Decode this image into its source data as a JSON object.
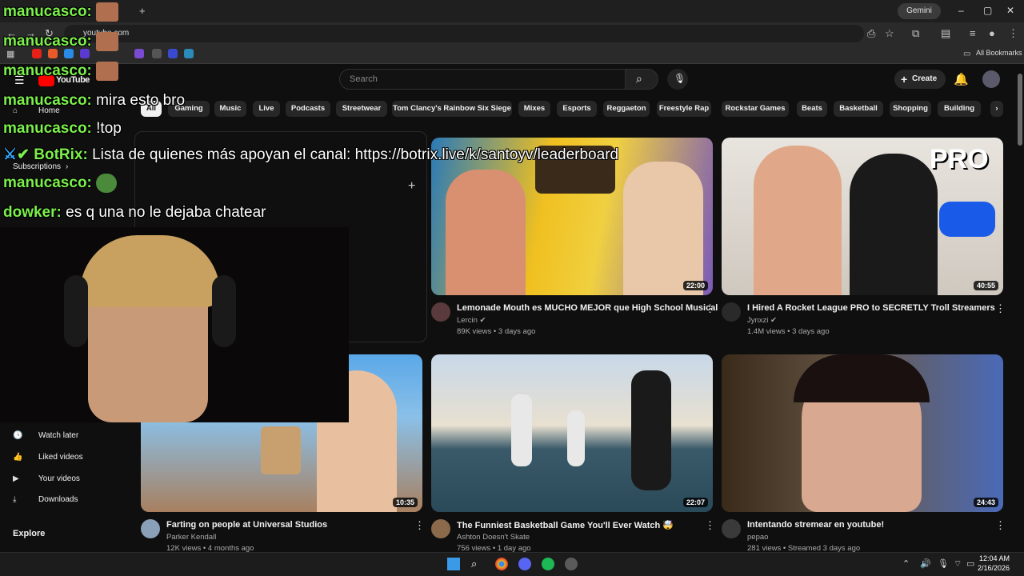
{
  "browser": {
    "url": "youtube.com",
    "gemini_label": "Gemini",
    "all_bookmarks": "All Bookmarks"
  },
  "youtube": {
    "logo_text": "YouTube",
    "search_placeholder": "Search",
    "create_label": "Create",
    "chips": [
      "All",
      "Gaming",
      "Music",
      "Live",
      "Podcasts",
      "Streetwear",
      "Tom Clancy's Rainbow Six Siege",
      "Mixes",
      "Esports",
      "Reggaeton",
      "Freestyle Rap",
      "Rockstar Games",
      "Beats",
      "Basketball",
      "Shopping",
      "Building"
    ],
    "sidebar": {
      "home": "Home",
      "subscriptions": "Subscriptions",
      "watch_later": "Watch later",
      "liked_videos": "Liked videos",
      "your_videos": "Your videos",
      "downloads": "Downloads",
      "explore": "Explore"
    },
    "videos": [
      {
        "title": "Lemonade Mouth es MUCHO MEJOR que High School Musical",
        "channel": "Lercin",
        "meta": "89K views • 3 days ago",
        "duration": "22:00"
      },
      {
        "title": "I Hired A Rocket League PRO to SECRETLY Troll Streamers",
        "channel": "Jynxzi",
        "meta": "1.4M views • 3 days ago",
        "duration": "40:55"
      },
      {
        "title": "Farting on people at Universal Studios",
        "channel": "Parker Kendall",
        "meta": "12K views • 4 months ago",
        "duration": "10:35"
      },
      {
        "title": "The Funniest Basketball Game You'll Ever Watch 🤯",
        "channel": "Ashton Doesn't Skate",
        "meta": "756 views • 1 day ago",
        "duration": "22:07"
      },
      {
        "title": "Intentando stremear en youtube!",
        "channel": "pepao",
        "meta": "281 views • Streamed 3 days ago",
        "duration": "24:43"
      }
    ],
    "thumb_overlay_text": "PRO"
  },
  "chat": [
    {
      "user": "manucasco:",
      "msg": ""
    },
    {
      "user": "manucasco:",
      "msg": ""
    },
    {
      "user": "manucasco:",
      "msg": ""
    },
    {
      "user": "manucasco:",
      "msg": "mira esto bro"
    },
    {
      "user": "manucasco:",
      "msg": "!top"
    },
    {
      "user": "BotRix:",
      "msg": "Lista de quienes más apoyan el canal: https://botrix.live/k/santoyv/leaderboard"
    },
    {
      "user": "manucasco:",
      "msg": ""
    },
    {
      "user": "dowker:",
      "msg": "es q una no le dejaba chatear"
    }
  ],
  "taskbar": {
    "time": "12:04 AM",
    "date": "2/16/2026"
  },
  "colors": {
    "background": "#0f0f0f",
    "chat_user": "#7cf04a",
    "youtube_red": "#ff0000"
  }
}
